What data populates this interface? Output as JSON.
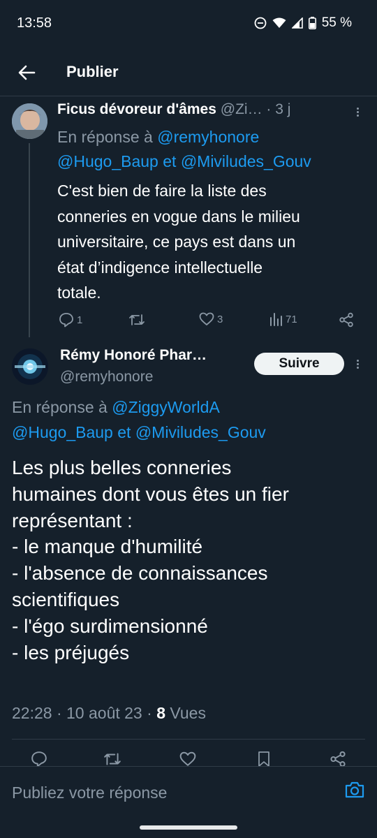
{
  "status": {
    "time": "13:58",
    "battery": "55 %"
  },
  "header": {
    "title": "Publier"
  },
  "parent_tweet": {
    "display_name": "Ficus dévoreur d'âmes",
    "handle": "@Zi…",
    "dot": "·",
    "age": "3 j",
    "reply_prefix": "En réponse à",
    "mention_1": "@remyhonore",
    "mention_2": "@Hugo_Baup",
    "and_word": "et",
    "mention_3": "@Miviludes_Gouv",
    "text_lines": [
      "C'est bien de faire la liste des",
      "conneries en vogue dans le milieu",
      "universitaire, ce pays est dans un",
      "état d’indigence intellectuelle",
      "totale."
    ],
    "reply_count": "1",
    "like_count": "3",
    "view_count": "71"
  },
  "main_tweet": {
    "display_name": "Rémy Honoré Phar…",
    "handle": "@remyhonore",
    "follow_label": "Suivre",
    "reply_prefix": "En réponse à",
    "mention_1": "@ZiggyWorldA",
    "mention_2": "@Hugo_Baup",
    "and_word": "et",
    "mention_3": "@Miviludes_Gouv",
    "text_lines": [
      "Les plus belles conneries",
      "humaines dont vous êtes un fier",
      "représentant :",
      "- le manque d'humilité",
      "- l'absence de connaissances",
      "scientifiques",
      "- l'égo surdimensionné",
      "- les préjugés"
    ],
    "time": "22:28",
    "dot_1": "·",
    "date": "10 août 23",
    "dot_2": "·",
    "views": "8",
    "views_label": "Vues"
  },
  "reply_box": {
    "placeholder": "Publiez votre réponse"
  },
  "colors": {
    "background": "#15202b",
    "accent": "#1d9bf0",
    "muted": "#8b98a5"
  },
  "icons": [
    "back-arrow-icon",
    "dnd-icon",
    "wifi-icon",
    "signal-icon",
    "battery-icon",
    "reply-icon",
    "retweet-icon",
    "like-icon",
    "views-icon",
    "share-icon",
    "bookmark-icon",
    "camera-icon",
    "more-icon"
  ]
}
